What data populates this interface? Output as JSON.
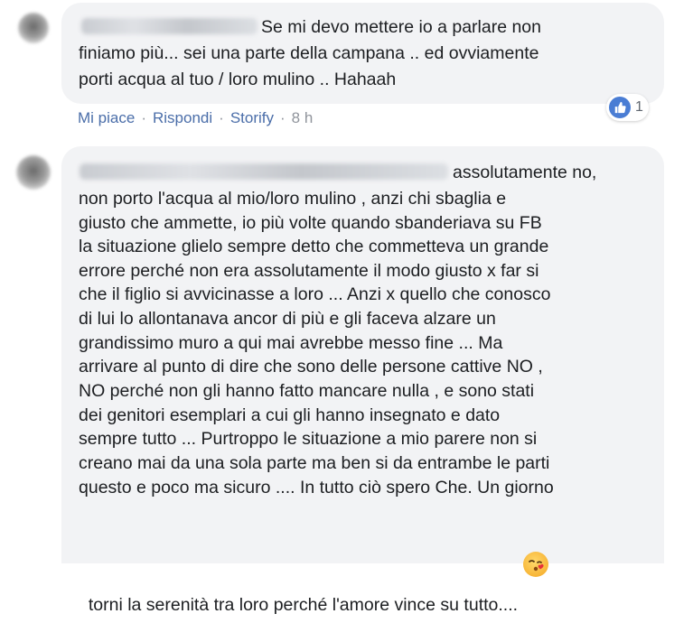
{
  "comment1": {
    "text_line1": "Se mi devo mettere io a parlare non",
    "text_line2": "finiamo più... sei una parte della campana .. ed ovviamente",
    "text_line3": "porti acqua al tuo / loro mulino .. Hahaah",
    "actions": {
      "like": "Mi piace",
      "reply": "Rispondi",
      "storify": "Storify",
      "separator": "·",
      "time": "8 h"
    },
    "reaction_count": "1"
  },
  "comment2": {
    "lines": [
      "assolutamente no,",
      "non porto l'acqua al mio/loro mulino , anzi chi sbaglia e",
      "giusto che ammette, io più volte quando sbanderiava su FB",
      "la situazione glielo sempre detto che commetteva un grande",
      "errore perché non era assolutamente il modo giusto x far si",
      "che il figlio si avvicinasse a loro ... Anzi x quello che conosco",
      "di lui lo allontanava ancor di più e gli faceva alzare un",
      "grandissimo muro a qui mai avrebbe messo fine ... Ma",
      "arrivare al punto di dire che sono delle persone cattive NO ,",
      "NO perché non gli hanno fatto mancare nulla , e sono stati",
      "dei genitori esemplari a cui gli hanno insegnato e dato",
      "sempre tutto ... Purtroppo le situazione a mio parere non si",
      "creano mai da una sola parte ma ben si da entrambe le parti",
      "questo e poco ma sicuro .... In tutto ciò spero Che. Un giorno",
      "torni la serenità tra loro perché l'amore vince su tutto...."
    ]
  },
  "colors": {
    "link": "#4b6ea9",
    "bubble": "#f2f3f5",
    "like": "#4a7dd4"
  },
  "icons": {
    "reaction": "like-thumb-icon",
    "emoji": "kissing-face-emoji"
  }
}
